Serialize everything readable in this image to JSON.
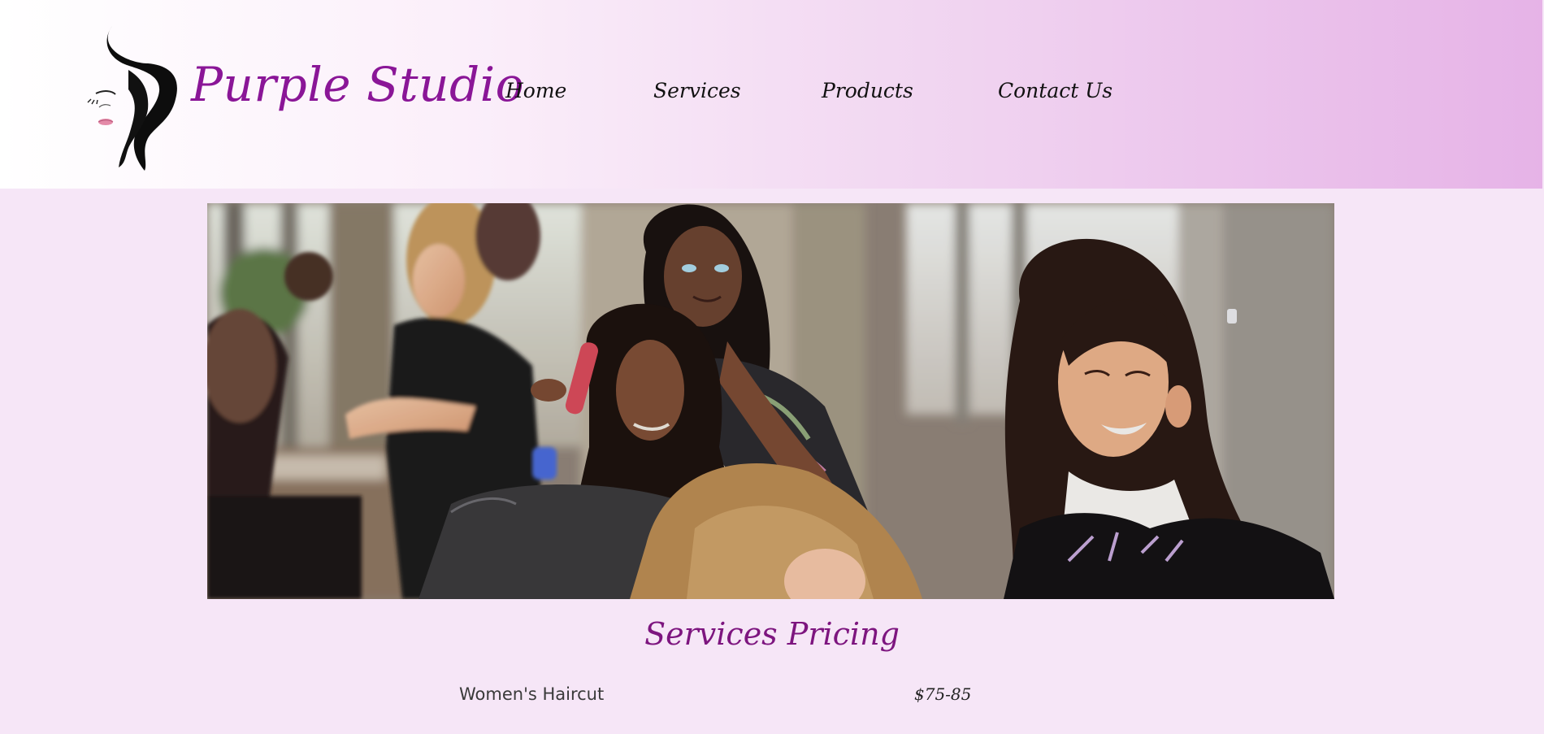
{
  "header": {
    "brand": "Purple Studio",
    "logo_icon": "woman-silhouette-logo",
    "nav": [
      {
        "label": "Home"
      },
      {
        "label": "Services"
      },
      {
        "label": "Products"
      },
      {
        "label": "Contact Us"
      }
    ]
  },
  "hero": {
    "image": "salon-stylists-photo"
  },
  "pricing": {
    "title": "Services Pricing",
    "items": [
      {
        "service": "Women's Haircut",
        "price": "$75-85"
      }
    ]
  },
  "colors": {
    "brand": "#8a1697",
    "title": "#7d157f",
    "page_bg": "#f6e6f7",
    "header_end": "#e6b3e7"
  }
}
